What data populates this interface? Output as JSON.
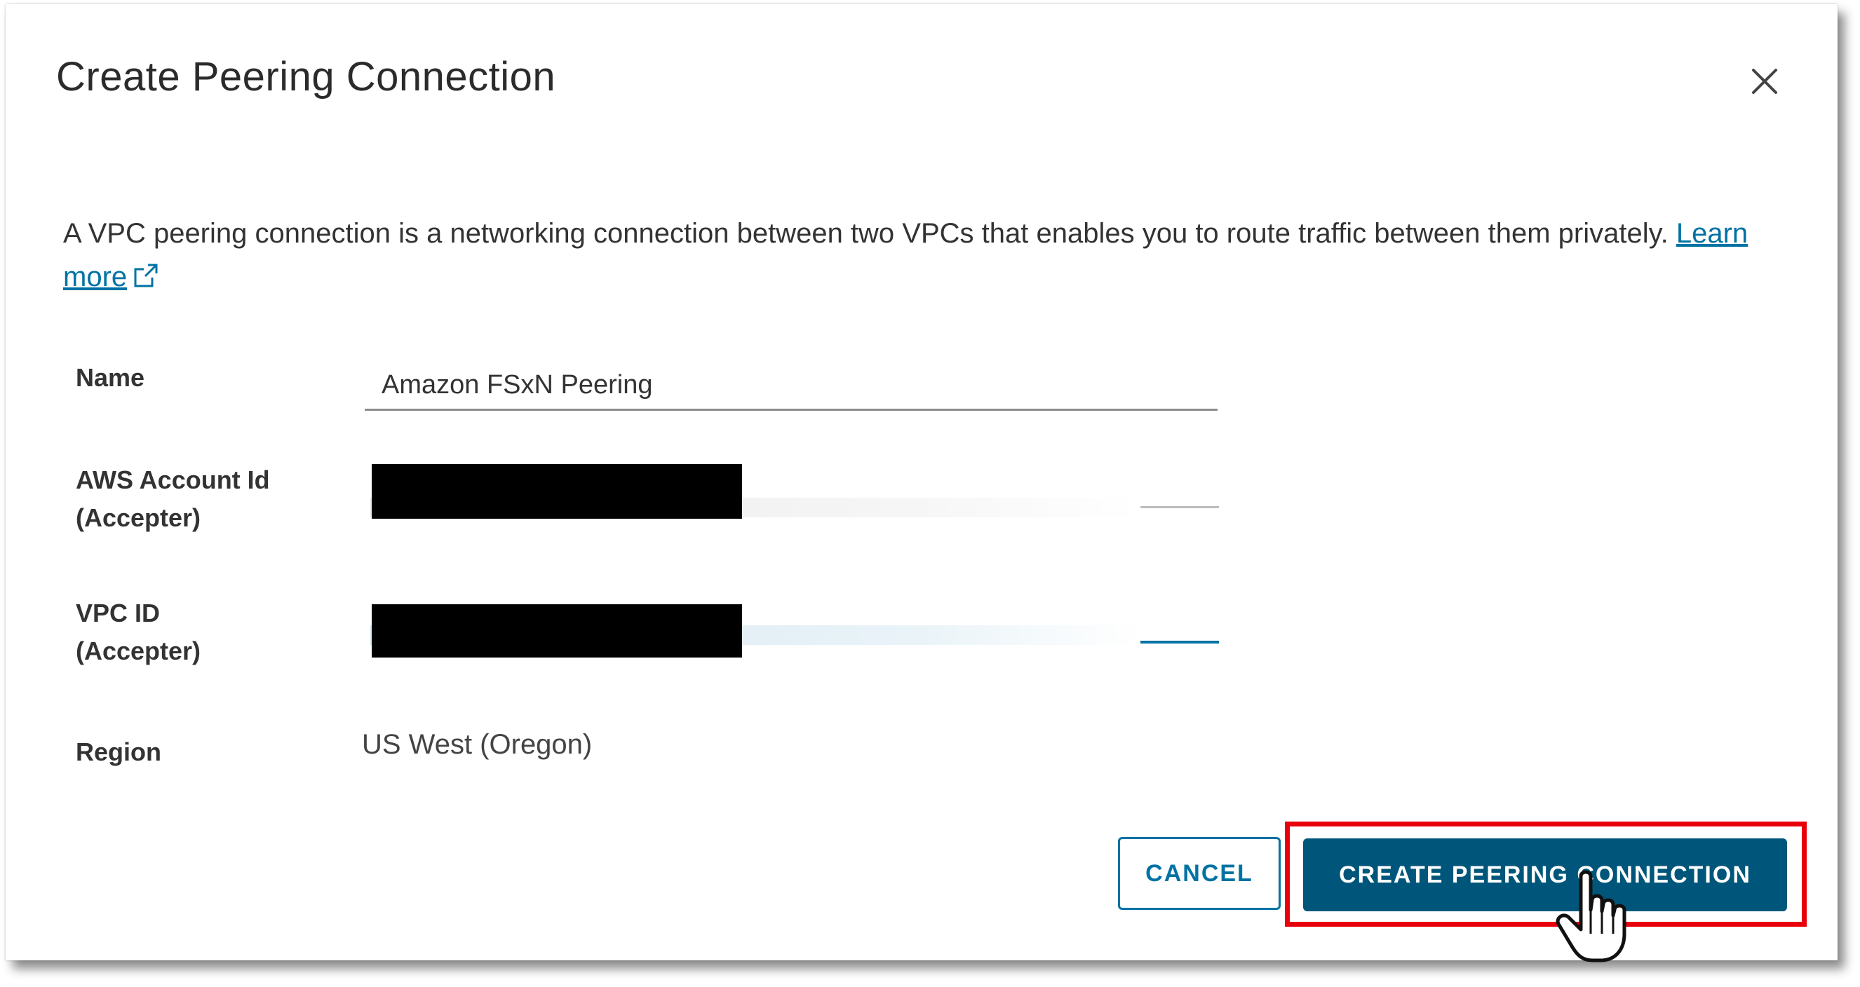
{
  "dialog": {
    "title": "Create Peering Connection",
    "close_icon": "close-icon",
    "description_text": "A VPC peering connection is a networking connection between two VPCs that enables you to route traffic between them privately. ",
    "learn_more_label": "Learn more",
    "learn_more_icon": "external-link-icon"
  },
  "form": {
    "name": {
      "label": "Name",
      "value": "Amazon FSxN Peering"
    },
    "aws_account_id": {
      "label_line1": "AWS Account Id",
      "label_line2": "(Accepter)",
      "value_redacted": true
    },
    "vpc_id": {
      "label_line1": "VPC ID",
      "label_line2": "(Accepter)",
      "value_redacted": true
    },
    "region": {
      "label": "Region",
      "value": "US West (Oregon)"
    }
  },
  "actions": {
    "cancel_label": "CANCEL",
    "create_label": "CREATE PEERING CONNECTION"
  },
  "colors": {
    "primary": "#00567a",
    "link": "#0072a3",
    "highlight": "#e8000b"
  }
}
